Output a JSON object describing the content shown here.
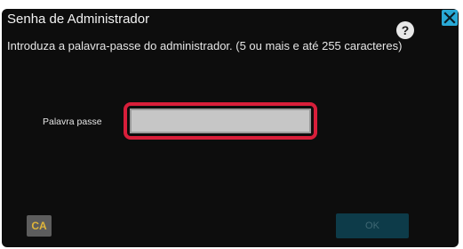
{
  "dialog": {
    "title": "Senha de Administrador",
    "help_icon": "question-mark-icon",
    "help_symbol": "?",
    "close_icon": "close-x-icon",
    "instruction": "Introduza a palavra-passe do administrador. (5 ou mais e até 255 caracteres)"
  },
  "form": {
    "password_label": "Palavra passe",
    "password_value": "",
    "highlight_color": "#d81e3a"
  },
  "buttons": {
    "clear_label": "CA",
    "ok_label": "OK",
    "ok_enabled": false
  },
  "colors": {
    "background": "#0d0d0d",
    "accent": "#29a9d6",
    "clear_text": "#e0b63a"
  }
}
